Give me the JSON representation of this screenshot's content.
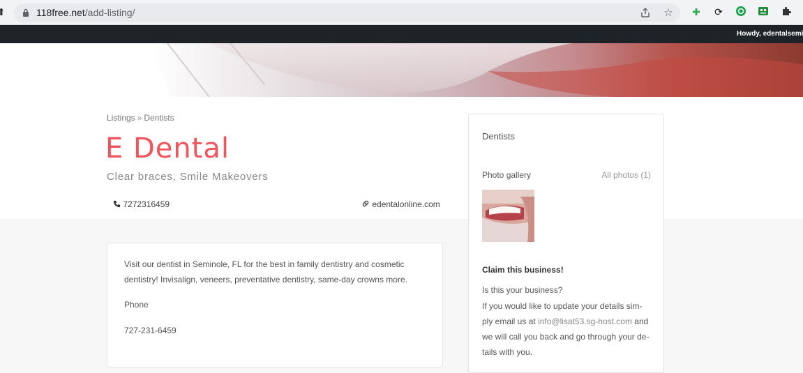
{
  "browser": {
    "url_host": "118free.net",
    "url_path": "/add-listing/"
  },
  "admin_bar": {
    "greeting": "Howdy, edentalsemi"
  },
  "breadcrumb": {
    "first": "Listings",
    "separator": "»",
    "second": "Dentists"
  },
  "listing": {
    "title": "E Dental",
    "tagline": "Clear braces, Smile Makeovers",
    "phone": "7272316459",
    "website": "edentalonline.com",
    "description": "Visit our dentist in Seminole, FL for the best in family dentistry and cosmetic dentistry! Invisalign, veneers, preventative dentistry, same-day crowns more.",
    "phone_label": "Phone",
    "phone_display": "727-231-6459"
  },
  "sidebar": {
    "category": "Dentists",
    "photo_gallery_label": "Photo gallery",
    "all_photos_label": "All photos (1)",
    "claim_title": "Claim this business!",
    "claim_question": "Is this your business?",
    "claim_text_before": "If you would like to update your details sim-ply email us at ",
    "claim_email": "info@lisat53.sg-host.com",
    "claim_text_after": " and we will call you back and go through your de-tails with you."
  },
  "icons": {
    "accent": "#f2545b"
  }
}
